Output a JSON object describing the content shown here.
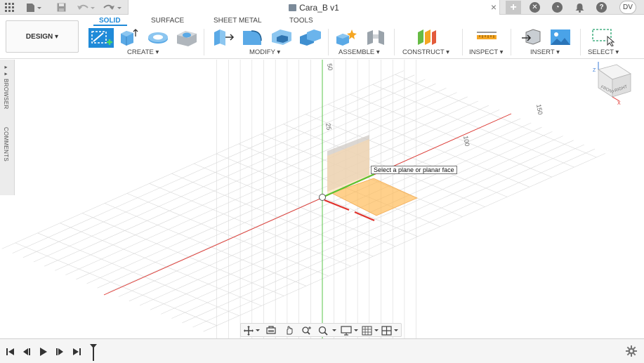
{
  "title_bar": {
    "doc_title": "Cara_B v1",
    "close_glyph": "×",
    "new_tab_glyph": "+",
    "user_initials": "DV",
    "icons": [
      "grid-menu-icon",
      "file-icon",
      "save-icon",
      "undo-icon",
      "redo-icon",
      "cube-icon",
      "extensions-icon",
      "job-status-icon",
      "bell-icon",
      "help-icon"
    ]
  },
  "ribbon": {
    "workspace_button": "DESIGN ▾",
    "tabs": [
      {
        "label": "SOLID",
        "active": true
      },
      {
        "label": "SURFACE",
        "active": false
      },
      {
        "label": "SHEET METAL",
        "active": false
      },
      {
        "label": "TOOLS",
        "active": false
      }
    ],
    "groups": [
      {
        "label": "CREATE ▾"
      },
      {
        "label": "MODIFY ▾"
      },
      {
        "label": "ASSEMBLE ▾"
      },
      {
        "label": "CONSTRUCT ▾"
      },
      {
        "label": "INSPECT ▾"
      },
      {
        "label": "INSERT ▾"
      },
      {
        "label": "SELECT ▾"
      }
    ]
  },
  "left_panel": {
    "browser_label": "BROWSER",
    "comments_label": "COMMENTS"
  },
  "viewport": {
    "tooltip": "Select a plane or planar face",
    "axis_ticks": [
      "50",
      "25",
      "100",
      "150"
    ],
    "viewcube": {
      "front": "FRONT",
      "right": "RIGHT",
      "z": "Z",
      "x": "X"
    },
    "colors": {
      "x_axis": "#e0332d",
      "y_axis": "#5cc330",
      "z_axis": "#59c64a",
      "plane_orange": "#ffb74d",
      "grid": "#d9d9d9"
    }
  },
  "navbar": {
    "icons": [
      "orbit-icon",
      "look-at-icon",
      "pan-icon",
      "zoom-icon",
      "zoom-window-icon",
      "display-settings-icon",
      "grid-settings-icon",
      "viewports-icon"
    ]
  },
  "timeline": {
    "icons": [
      "first-frame-icon",
      "previous-frame-icon",
      "play-icon",
      "next-frame-icon",
      "last-frame-icon",
      "timeline-marker-icon",
      "settings-gear-icon"
    ]
  }
}
